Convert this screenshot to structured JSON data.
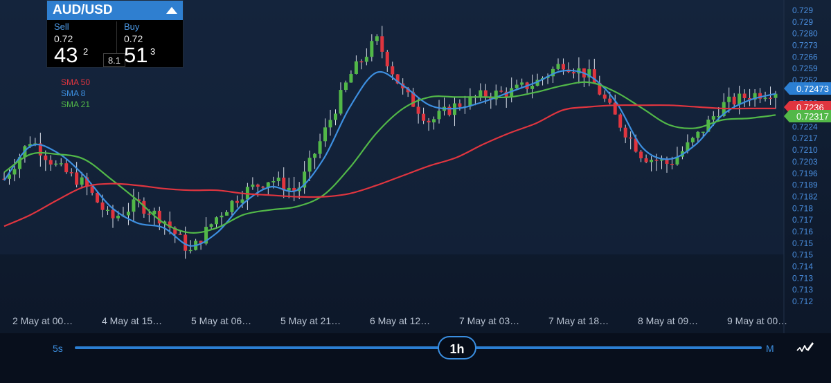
{
  "ticket": {
    "symbol": "AUD/USD",
    "sell_label": "Sell",
    "buy_label": "Buy",
    "sell_prefix": "0.72",
    "sell_big": "43",
    "sell_pip": "2",
    "buy_prefix": "0.72",
    "buy_big": "51",
    "buy_pip": "3",
    "spread": "8.1"
  },
  "indicators": [
    {
      "label": "SMA 50",
      "color": "#e0353f"
    },
    {
      "label": "SMA 8",
      "color": "#3d8fe0"
    },
    {
      "label": "SMA 21",
      "color": "#52b848"
    }
  ],
  "controls": {
    "min_timeframe": "5s",
    "current_timeframe": "1h",
    "max_timeframe": "M",
    "draw_tool_icon": "draw-tool-icon"
  },
  "chart_data": {
    "type": "candlestick",
    "y_tick_labels": [
      "0.729",
      "0.729",
      "0.7280",
      "0.7273",
      "0.7266",
      "0.7259",
      "0.7252",
      "0.7245",
      "0.7238",
      "0.7231",
      "0.7224",
      "0.7217",
      "0.7210",
      "0.7203",
      "0.7196",
      "0.7189",
      "0.7182",
      "0.718",
      "0.717",
      "0.716",
      "0.715",
      "0.715",
      "0.714",
      "0.713",
      "0.713",
      "0.712"
    ],
    "ylim": [
      0.7118,
      0.7296
    ],
    "x_tick_labels": [
      "2 May at 00…",
      "4 May at 15…",
      "5 May at 06…",
      "5 May at 21…",
      "6 May at 12…",
      "7 May at 03…",
      "7 May at 18…",
      "8 May at 09…",
      "9 May at 00…"
    ],
    "price_tags": [
      {
        "label": "0.72473",
        "value": 0.72473,
        "color": "#2b7fd3"
      },
      {
        "label": "0.7236",
        "value": 0.7236,
        "color": "#e0353f"
      },
      {
        "label": "0.72317",
        "value": 0.72317,
        "color": "#52b848"
      }
    ],
    "candle_colors": {
      "up": "#52b848",
      "down": "#e0353f"
    },
    "key_prices": [
      0.7193,
      0.7217,
      0.72,
      0.719,
      0.7168,
      0.7178,
      0.7168,
      0.7148,
      0.717,
      0.7185,
      0.7193,
      0.7185,
      0.722,
      0.7256,
      0.7278,
      0.7246,
      0.7228,
      0.7238,
      0.7244,
      0.7246,
      0.7252,
      0.7264,
      0.7256,
      0.723,
      0.7207,
      0.7202,
      0.7218,
      0.7238,
      0.7244,
      0.7247
    ],
    "series": [
      {
        "name": "SMA 8",
        "color": "#3d8fe0",
        "values": [
          0.7192,
          0.7213,
          0.7209,
          0.7195,
          0.7176,
          0.7166,
          0.7163,
          0.7152,
          0.716,
          0.7178,
          0.7188,
          0.7186,
          0.7205,
          0.7237,
          0.7258,
          0.725,
          0.7238,
          0.7236,
          0.724,
          0.7246,
          0.7252,
          0.7259,
          0.7256,
          0.724,
          0.7212,
          0.7205,
          0.7214,
          0.7232,
          0.7241,
          0.7245
        ]
      },
      {
        "name": "SMA 21",
        "color": "#52b848",
        "values": [
          0.7197,
          0.7208,
          0.7208,
          0.7205,
          0.7193,
          0.718,
          0.7166,
          0.716,
          0.7163,
          0.7171,
          0.7174,
          0.7176,
          0.7183,
          0.72,
          0.7221,
          0.7236,
          0.7243,
          0.7243,
          0.7243,
          0.7243,
          0.7246,
          0.725,
          0.7252,
          0.7246,
          0.7236,
          0.7226,
          0.7224,
          0.7229,
          0.723,
          0.7232
        ]
      },
      {
        "name": "SMA 50",
        "color": "#e0353f",
        "values": [
          0.7164,
          0.7171,
          0.718,
          0.7188,
          0.719,
          0.7189,
          0.7187,
          0.7186,
          0.7186,
          0.7184,
          0.7183,
          0.7182,
          0.7182,
          0.7184,
          0.7189,
          0.7195,
          0.7201,
          0.7206,
          0.7214,
          0.7221,
          0.7227,
          0.7235,
          0.7237,
          0.7238,
          0.7238,
          0.7238,
          0.7237,
          0.7236,
          0.7236,
          0.7236
        ]
      }
    ]
  }
}
